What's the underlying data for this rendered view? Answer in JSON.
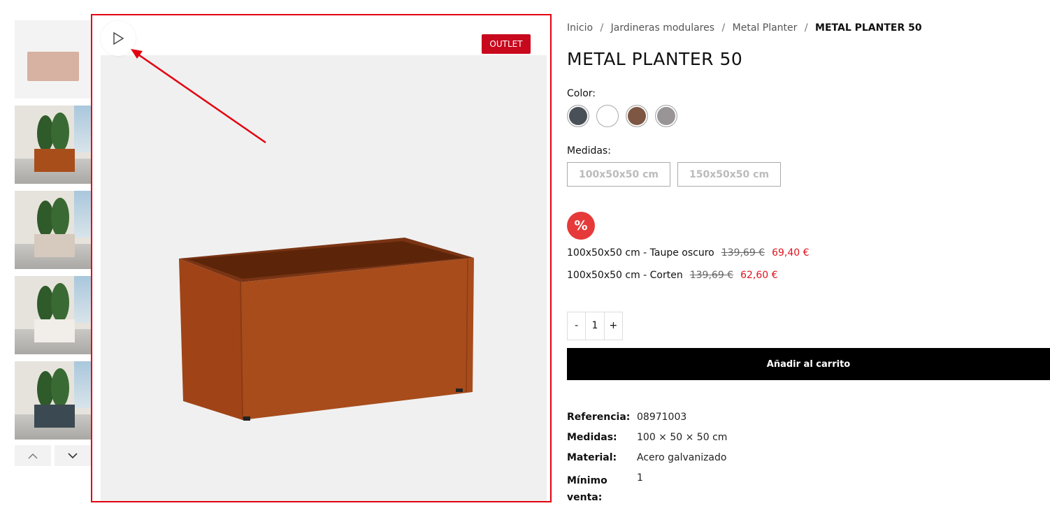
{
  "thumbnails": [
    {
      "type": "plain",
      "planter_color": "#d7b1a1"
    },
    {
      "type": "scene",
      "planter_color": "#a84e1b"
    },
    {
      "type": "scene",
      "planter_color": "#d6c9bd"
    },
    {
      "type": "scene",
      "planter_color": "#f1ede8"
    },
    {
      "type": "scene",
      "planter_color": "#3b4a52"
    }
  ],
  "thumb_nav": {
    "up_icon": "chevron-up-icon",
    "down_icon": "chevron-down-icon"
  },
  "main_image": {
    "badge": "OUTLET",
    "play_icon": "play-icon",
    "planter_color": "#a6481b"
  },
  "breadcrumb": [
    {
      "label": "Inicio",
      "current": false
    },
    {
      "label": "Jardineras modulares",
      "current": false
    },
    {
      "label": "Metal Planter",
      "current": false
    },
    {
      "label": "METAL PLANTER 50",
      "current": true
    }
  ],
  "breadcrumb_separator": "/",
  "product": {
    "title": "METAL PLANTER 50",
    "color_label": "Color:",
    "colors": [
      "#4a5057",
      "#ffffff",
      "#7d5744",
      "#999596"
    ],
    "sizes_label": "Medidas:",
    "sizes": [
      "100x50x50 cm",
      "150x50x50 cm"
    ],
    "discount_icon": "%",
    "offers": [
      {
        "label": "100x50x50 cm - Taupe oscuro",
        "old_price": "139,69 €",
        "new_price": "69,40 €"
      },
      {
        "label": "100x50x50 cm - Corten",
        "old_price": "139,69 €",
        "new_price": "62,60 €"
      }
    ],
    "quantity": {
      "minus": "-",
      "value": "1",
      "plus": "+"
    },
    "add_to_cart": "Añadir al carrito",
    "specs": [
      {
        "key": "Referencia:",
        "value": "08971003"
      },
      {
        "key": "Medidas:",
        "value": "100 × 50 × 50 cm"
      },
      {
        "key": "Material:",
        "value": "Acero galvanizado"
      },
      {
        "key": "Mínimo venta:",
        "value": "1"
      }
    ]
  },
  "colors": {
    "accent_red": "#e3000f",
    "badge_red": "#c8081d",
    "price_red": "#e0141e",
    "discount_red": "#e63a3a"
  }
}
